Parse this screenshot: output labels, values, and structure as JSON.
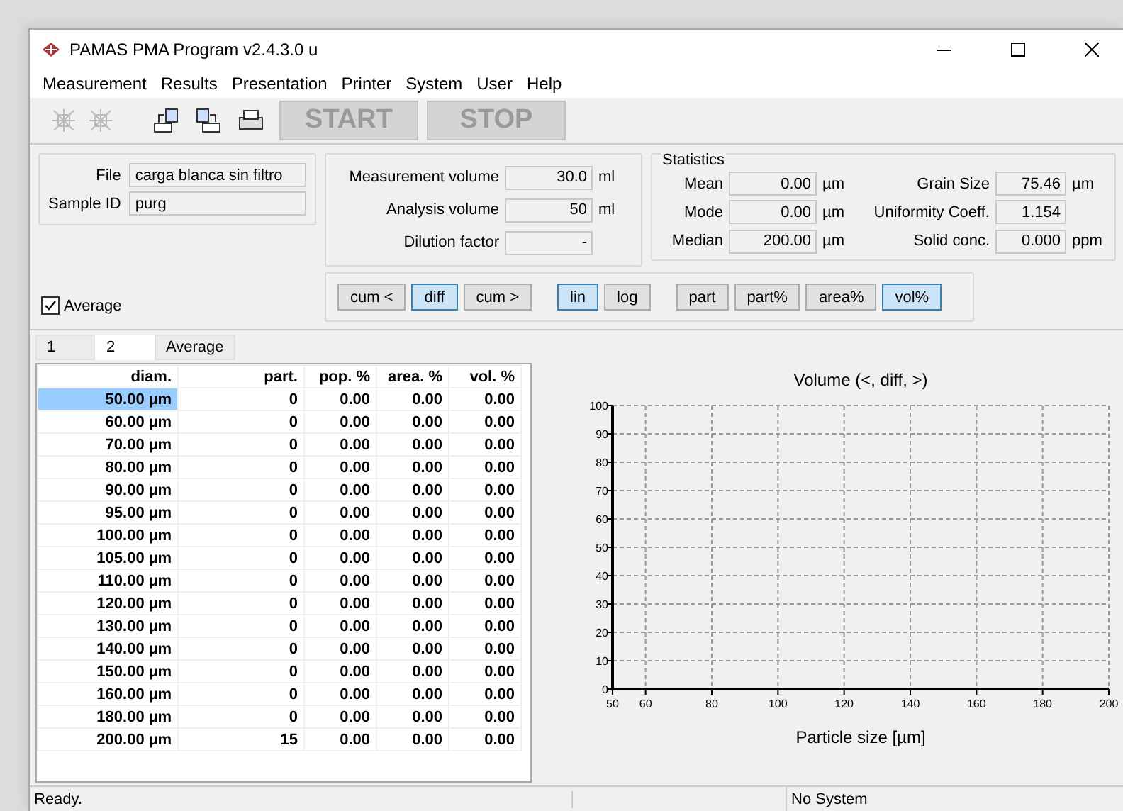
{
  "window": {
    "title": "PAMAS PMA Program v2.4.3.0 u"
  },
  "menu": [
    "Measurement",
    "Results",
    "Presentation",
    "Printer",
    "System",
    "User",
    "Help"
  ],
  "toolbar": {
    "icons": [
      {
        "kind": "sensor",
        "disabled": true
      },
      {
        "kind": "sensor",
        "disabled": true
      },
      {
        "kind": "export",
        "disabled": false
      },
      {
        "kind": "import",
        "disabled": false
      },
      {
        "kind": "print",
        "disabled": false
      }
    ],
    "buttons": [
      {
        "label": "START",
        "disabled": true
      },
      {
        "label": "STOP",
        "disabled": true
      }
    ]
  },
  "sample": [
    {
      "label": "File",
      "value": "carga blanca sin filtro"
    },
    {
      "label": "Sample ID",
      "value": "purg"
    }
  ],
  "volumes": [
    {
      "label": "Measurement volume",
      "value": "30.0",
      "unit": "ml"
    },
    {
      "label": "Analysis volume",
      "value": "50",
      "unit": "ml"
    },
    {
      "label": "Dilution factor",
      "value": "-"
    }
  ],
  "statistics": {
    "title": "Statistics",
    "left": [
      {
        "label": "Mean",
        "value": "0.00",
        "unit": "µm"
      },
      {
        "label": "Mode",
        "value": "0.00",
        "unit": "µm"
      },
      {
        "label": "Median",
        "value": "200.00",
        "unit": "µm"
      }
    ],
    "right": [
      {
        "label": "Grain Size",
        "value": "75.46",
        "unit": "µm"
      },
      {
        "label": "Uniformity Coeff.",
        "value": "1.154"
      },
      {
        "label": "Solid conc.",
        "value": "0.000",
        "unit": "ppm"
      }
    ]
  },
  "average": {
    "label": "Average",
    "checked": true
  },
  "mode_groups": [
    [
      {
        "label": "cum <",
        "selected": false
      },
      {
        "label": "diff",
        "selected": true
      },
      {
        "label": "cum >",
        "selected": false
      }
    ],
    [
      {
        "label": "lin",
        "selected": true
      },
      {
        "label": "log",
        "selected": false
      }
    ],
    [
      {
        "label": "part",
        "selected": false
      },
      {
        "label": "part%",
        "selected": false
      },
      {
        "label": "area%",
        "selected": false
      },
      {
        "label": "vol%",
        "selected": true
      }
    ]
  ],
  "tabs": [
    {
      "label": "1",
      "selected": false
    },
    {
      "label": "2",
      "selected": true
    },
    {
      "label": "Average",
      "selected": false
    }
  ],
  "table": {
    "columns": [
      "diam.",
      "part.",
      "pop. %",
      "area. %",
      "vol. %"
    ],
    "rows": [
      {
        "cells": [
          "50.00 µm",
          "0",
          "0.00",
          "0.00",
          "0.00"
        ],
        "selected": true
      },
      {
        "cells": [
          "60.00 µm",
          "0",
          "0.00",
          "0.00",
          "0.00"
        ],
        "selected": false
      },
      {
        "cells": [
          "70.00 µm",
          "0",
          "0.00",
          "0.00",
          "0.00"
        ],
        "selected": false
      },
      {
        "cells": [
          "80.00 µm",
          "0",
          "0.00",
          "0.00",
          "0.00"
        ],
        "selected": false
      },
      {
        "cells": [
          "90.00 µm",
          "0",
          "0.00",
          "0.00",
          "0.00"
        ],
        "selected": false
      },
      {
        "cells": [
          "95.00 µm",
          "0",
          "0.00",
          "0.00",
          "0.00"
        ],
        "selected": false
      },
      {
        "cells": [
          "100.00 µm",
          "0",
          "0.00",
          "0.00",
          "0.00"
        ],
        "selected": false
      },
      {
        "cells": [
          "105.00 µm",
          "0",
          "0.00",
          "0.00",
          "0.00"
        ],
        "selected": false
      },
      {
        "cells": [
          "110.00 µm",
          "0",
          "0.00",
          "0.00",
          "0.00"
        ],
        "selected": false
      },
      {
        "cells": [
          "120.00 µm",
          "0",
          "0.00",
          "0.00",
          "0.00"
        ],
        "selected": false
      },
      {
        "cells": [
          "130.00 µm",
          "0",
          "0.00",
          "0.00",
          "0.00"
        ],
        "selected": false
      },
      {
        "cells": [
          "140.00 µm",
          "0",
          "0.00",
          "0.00",
          "0.00"
        ],
        "selected": false
      },
      {
        "cells": [
          "150.00 µm",
          "0",
          "0.00",
          "0.00",
          "0.00"
        ],
        "selected": false
      },
      {
        "cells": [
          "160.00 µm",
          "0",
          "0.00",
          "0.00",
          "0.00"
        ],
        "selected": false
      },
      {
        "cells": [
          "180.00 µm",
          "0",
          "0.00",
          "0.00",
          "0.00"
        ],
        "selected": false
      },
      {
        "cells": [
          "200.00 µm",
          "15",
          "0.00",
          "0.00",
          "0.00"
        ],
        "selected": false
      }
    ]
  },
  "chart_data": {
    "type": "line",
    "title": "Volume (<, diff, >)",
    "xlabel": "Particle size [µm]",
    "xlim": [
      50,
      200
    ],
    "ylim": [
      0,
      100
    ],
    "xticks": [
      50,
      60,
      80,
      100,
      120,
      140,
      160,
      180,
      200
    ],
    "yticks": [
      0,
      10,
      20,
      30,
      40,
      50,
      60,
      70,
      80,
      90,
      100
    ],
    "grid": true
  },
  "status_bar": [
    "Ready.",
    "No System"
  ]
}
